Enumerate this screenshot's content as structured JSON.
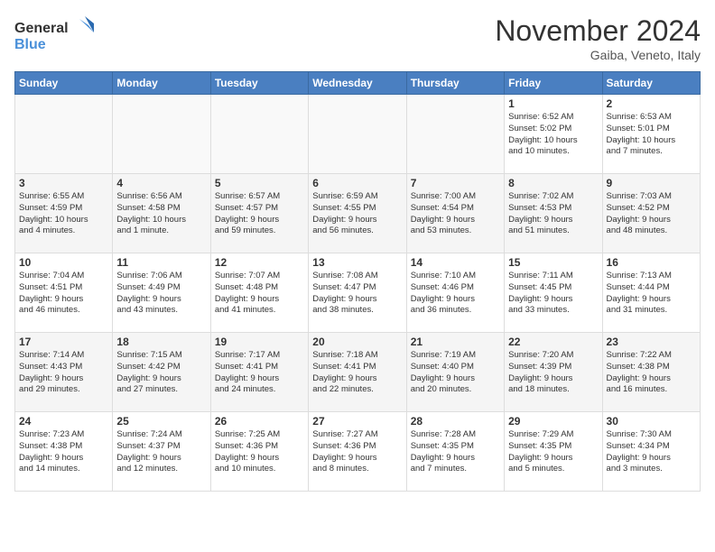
{
  "logo": {
    "line1": "General",
    "line2": "Blue"
  },
  "title": "November 2024",
  "location": "Gaiba, Veneto, Italy",
  "weekdays": [
    "Sunday",
    "Monday",
    "Tuesday",
    "Wednesday",
    "Thursday",
    "Friday",
    "Saturday"
  ],
  "weeks": [
    [
      {
        "day": "",
        "info": ""
      },
      {
        "day": "",
        "info": ""
      },
      {
        "day": "",
        "info": ""
      },
      {
        "day": "",
        "info": ""
      },
      {
        "day": "",
        "info": ""
      },
      {
        "day": "1",
        "info": "Sunrise: 6:52 AM\nSunset: 5:02 PM\nDaylight: 10 hours\nand 10 minutes."
      },
      {
        "day": "2",
        "info": "Sunrise: 6:53 AM\nSunset: 5:01 PM\nDaylight: 10 hours\nand 7 minutes."
      }
    ],
    [
      {
        "day": "3",
        "info": "Sunrise: 6:55 AM\nSunset: 4:59 PM\nDaylight: 10 hours\nand 4 minutes."
      },
      {
        "day": "4",
        "info": "Sunrise: 6:56 AM\nSunset: 4:58 PM\nDaylight: 10 hours\nand 1 minute."
      },
      {
        "day": "5",
        "info": "Sunrise: 6:57 AM\nSunset: 4:57 PM\nDaylight: 9 hours\nand 59 minutes."
      },
      {
        "day": "6",
        "info": "Sunrise: 6:59 AM\nSunset: 4:55 PM\nDaylight: 9 hours\nand 56 minutes."
      },
      {
        "day": "7",
        "info": "Sunrise: 7:00 AM\nSunset: 4:54 PM\nDaylight: 9 hours\nand 53 minutes."
      },
      {
        "day": "8",
        "info": "Sunrise: 7:02 AM\nSunset: 4:53 PM\nDaylight: 9 hours\nand 51 minutes."
      },
      {
        "day": "9",
        "info": "Sunrise: 7:03 AM\nSunset: 4:52 PM\nDaylight: 9 hours\nand 48 minutes."
      }
    ],
    [
      {
        "day": "10",
        "info": "Sunrise: 7:04 AM\nSunset: 4:51 PM\nDaylight: 9 hours\nand 46 minutes."
      },
      {
        "day": "11",
        "info": "Sunrise: 7:06 AM\nSunset: 4:49 PM\nDaylight: 9 hours\nand 43 minutes."
      },
      {
        "day": "12",
        "info": "Sunrise: 7:07 AM\nSunset: 4:48 PM\nDaylight: 9 hours\nand 41 minutes."
      },
      {
        "day": "13",
        "info": "Sunrise: 7:08 AM\nSunset: 4:47 PM\nDaylight: 9 hours\nand 38 minutes."
      },
      {
        "day": "14",
        "info": "Sunrise: 7:10 AM\nSunset: 4:46 PM\nDaylight: 9 hours\nand 36 minutes."
      },
      {
        "day": "15",
        "info": "Sunrise: 7:11 AM\nSunset: 4:45 PM\nDaylight: 9 hours\nand 33 minutes."
      },
      {
        "day": "16",
        "info": "Sunrise: 7:13 AM\nSunset: 4:44 PM\nDaylight: 9 hours\nand 31 minutes."
      }
    ],
    [
      {
        "day": "17",
        "info": "Sunrise: 7:14 AM\nSunset: 4:43 PM\nDaylight: 9 hours\nand 29 minutes."
      },
      {
        "day": "18",
        "info": "Sunrise: 7:15 AM\nSunset: 4:42 PM\nDaylight: 9 hours\nand 27 minutes."
      },
      {
        "day": "19",
        "info": "Sunrise: 7:17 AM\nSunset: 4:41 PM\nDaylight: 9 hours\nand 24 minutes."
      },
      {
        "day": "20",
        "info": "Sunrise: 7:18 AM\nSunset: 4:41 PM\nDaylight: 9 hours\nand 22 minutes."
      },
      {
        "day": "21",
        "info": "Sunrise: 7:19 AM\nSunset: 4:40 PM\nDaylight: 9 hours\nand 20 minutes."
      },
      {
        "day": "22",
        "info": "Sunrise: 7:20 AM\nSunset: 4:39 PM\nDaylight: 9 hours\nand 18 minutes."
      },
      {
        "day": "23",
        "info": "Sunrise: 7:22 AM\nSunset: 4:38 PM\nDaylight: 9 hours\nand 16 minutes."
      }
    ],
    [
      {
        "day": "24",
        "info": "Sunrise: 7:23 AM\nSunset: 4:38 PM\nDaylight: 9 hours\nand 14 minutes."
      },
      {
        "day": "25",
        "info": "Sunrise: 7:24 AM\nSunset: 4:37 PM\nDaylight: 9 hours\nand 12 minutes."
      },
      {
        "day": "26",
        "info": "Sunrise: 7:25 AM\nSunset: 4:36 PM\nDaylight: 9 hours\nand 10 minutes."
      },
      {
        "day": "27",
        "info": "Sunrise: 7:27 AM\nSunset: 4:36 PM\nDaylight: 9 hours\nand 8 minutes."
      },
      {
        "day": "28",
        "info": "Sunrise: 7:28 AM\nSunset: 4:35 PM\nDaylight: 9 hours\nand 7 minutes."
      },
      {
        "day": "29",
        "info": "Sunrise: 7:29 AM\nSunset: 4:35 PM\nDaylight: 9 hours\nand 5 minutes."
      },
      {
        "day": "30",
        "info": "Sunrise: 7:30 AM\nSunset: 4:34 PM\nDaylight: 9 hours\nand 3 minutes."
      }
    ]
  ]
}
